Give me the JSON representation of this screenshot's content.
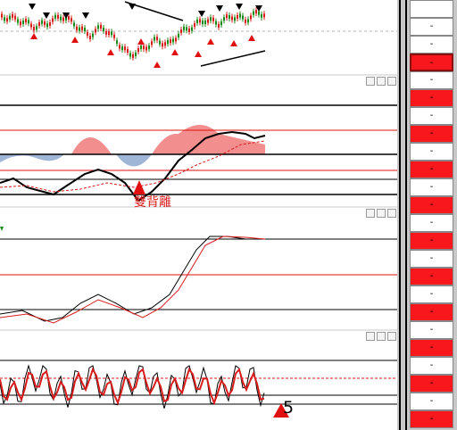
{
  "app": {
    "title": ""
  },
  "annotations": {
    "divergence_label": "雙背離",
    "count_label": "5"
  },
  "panels": [
    {
      "name": "price",
      "buttons": []
    },
    {
      "name": "indicator-1",
      "buttons": [
        "minimize",
        "maximize",
        "close"
      ]
    },
    {
      "name": "indicator-2",
      "buttons": [
        "minimize",
        "maximize",
        "close"
      ]
    },
    {
      "name": "indicator-3",
      "buttons": [
        "minimize",
        "maximize",
        "close"
      ]
    }
  ],
  "sidebar": {
    "cells": [
      {
        "label": "",
        "color": "white"
      },
      {
        "label": "-",
        "color": "white"
      },
      {
        "label": "-",
        "color": "white"
      },
      {
        "label": "-",
        "color": "red"
      },
      {
        "label": "-",
        "color": "white"
      },
      {
        "label": "-",
        "color": "red"
      },
      {
        "label": "-",
        "color": "white"
      },
      {
        "label": "-",
        "color": "red"
      },
      {
        "label": "-",
        "color": "white"
      },
      {
        "label": "-",
        "color": "red"
      },
      {
        "label": "-",
        "color": "white"
      },
      {
        "label": "-",
        "color": "red"
      },
      {
        "label": "-",
        "color": "white"
      },
      {
        "label": "-",
        "color": "red"
      },
      {
        "label": "-",
        "color": "white"
      },
      {
        "label": "-",
        "color": "red"
      },
      {
        "label": "-",
        "color": "white"
      },
      {
        "label": "-",
        "color": "red"
      },
      {
        "label": "-",
        "color": "white"
      },
      {
        "label": "-",
        "color": "red"
      },
      {
        "label": "-",
        "color": "white"
      },
      {
        "label": "-",
        "color": "red"
      },
      {
        "label": "-",
        "color": "white"
      },
      {
        "label": "-",
        "color": "red"
      }
    ]
  },
  "colors": {
    "up_candle": "#d81c1c",
    "down_candle": "#1a8a1a",
    "fill_positive": "#f28e8e",
    "fill_negative": "#9fb6d6",
    "signal_arrow_up": "#e01010",
    "guide_line": "#000000",
    "red_level": "#e01010",
    "sidebar_red": "#f7171c"
  },
  "chart_data": {
    "type": "line",
    "series": []
  }
}
